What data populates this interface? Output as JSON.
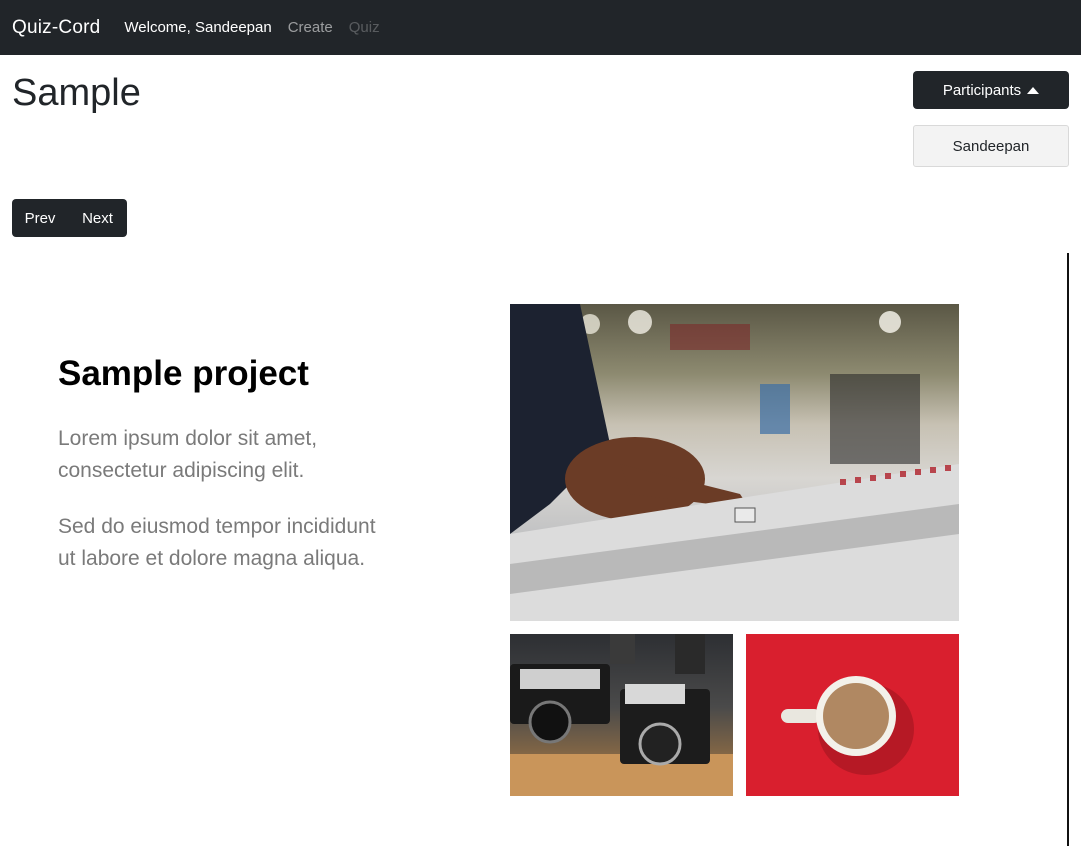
{
  "navbar": {
    "brand": "Quiz-Cord",
    "welcome": "Welcome, Sandeepan",
    "create": "Create",
    "quiz": "Quiz"
  },
  "page": {
    "title": "Sample"
  },
  "participants": {
    "button_label": "Participants",
    "items": [
      "Sandeepan"
    ]
  },
  "controls": {
    "prev": "Prev",
    "next": "Next"
  },
  "slide": {
    "title": "Sample project",
    "paragraphs": [
      "Lorem ipsum dolor sit amet, consectetur adipiscing elit.",
      "Sed do eiusmod tempor incididunt ut labore et dolore magna aliqua."
    ],
    "images": [
      "mixing-console-photo",
      "vintage-cameras-photo",
      "coffee-cup-photo"
    ]
  },
  "colors": {
    "navbar": "#212529",
    "accent_red": "#d91f2e",
    "text_muted": "#7a7a7a"
  }
}
